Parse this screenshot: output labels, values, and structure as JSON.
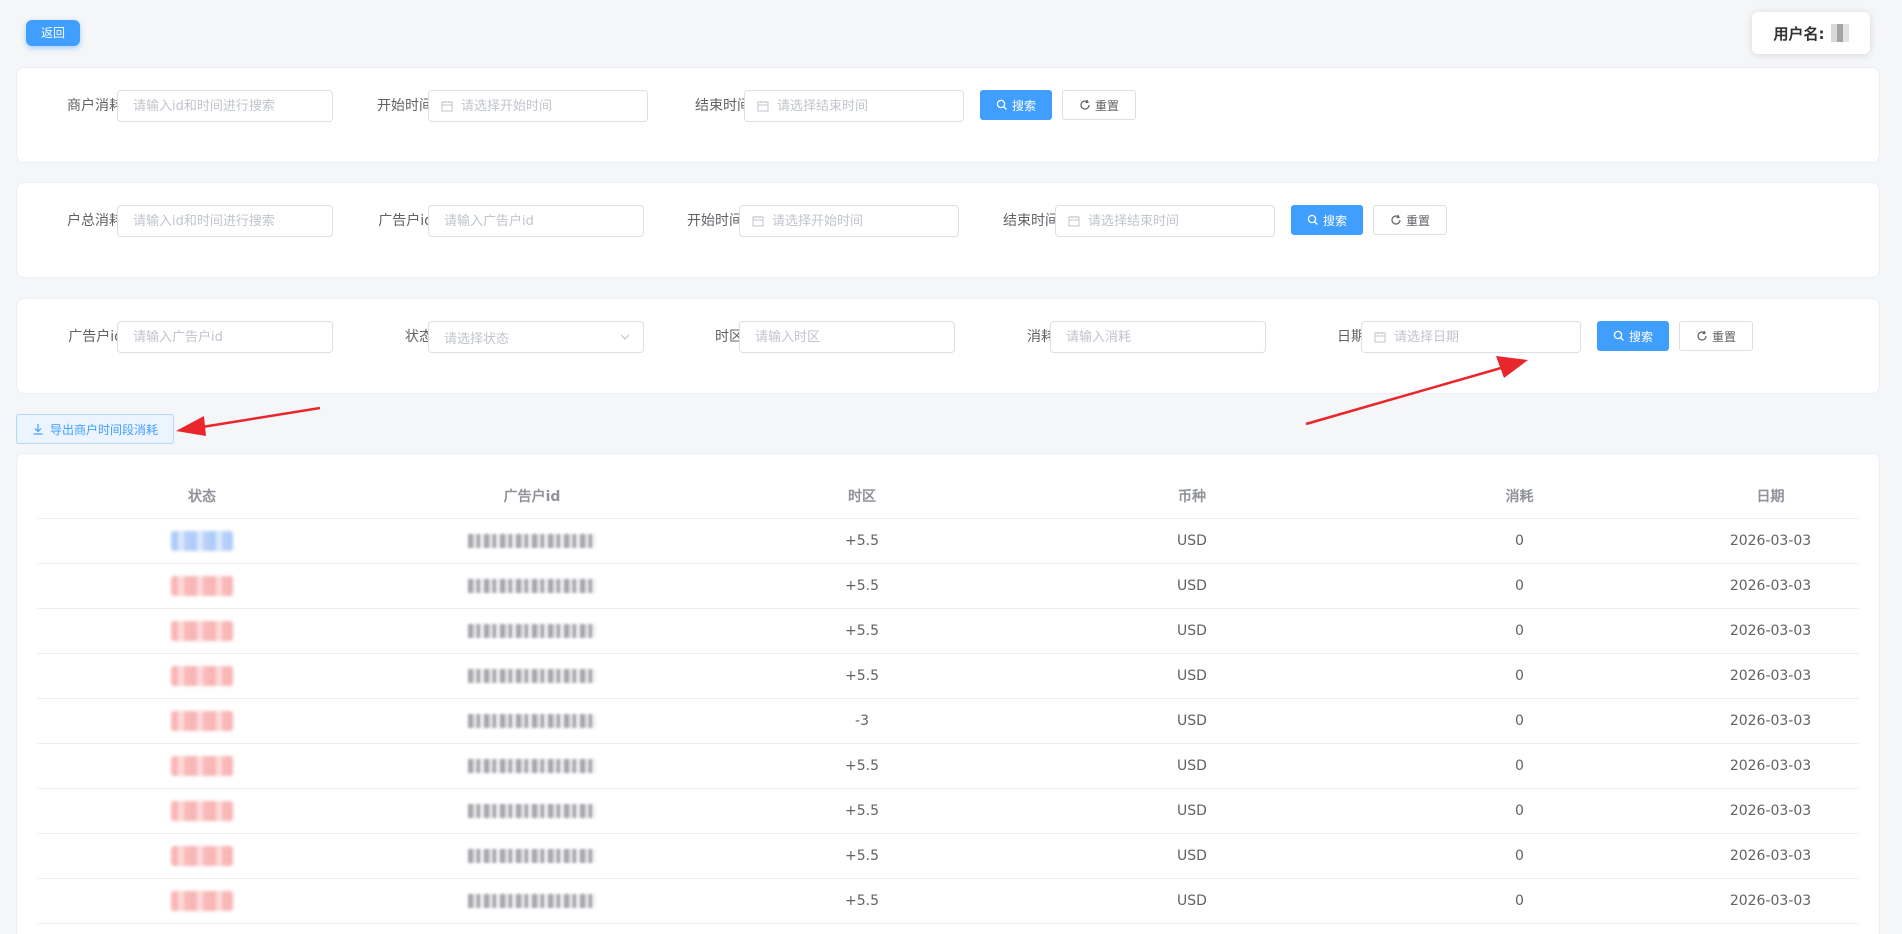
{
  "header": {
    "back_label": "返回",
    "user_label": "用户名:"
  },
  "merchant_form": {
    "label": "商户消耗",
    "placeholder": "请输入id和时间进行搜索",
    "start_label": "开始时间",
    "start_placeholder": "请选择开始时间",
    "end_label": "结束时间",
    "end_placeholder": "请选择结束时间",
    "search_label": "搜索",
    "reset_label": "重置"
  },
  "account_total_form": {
    "label": "户总消耗",
    "placeholder": "请输入id和时间进行搜索",
    "ad_id_label": "广告户id",
    "ad_id_placeholder": "请输入广告户id",
    "start_label": "开始时间",
    "start_placeholder": "请选择开始时间",
    "end_label": "结束时间",
    "end_placeholder": "请选择结束时间",
    "search_label": "搜索",
    "reset_label": "重置"
  },
  "detail_form": {
    "ad_id_label": "广告户id",
    "ad_id_placeholder": "请输入广告户id",
    "status_label": "状态",
    "status_placeholder": "请选择状态",
    "timezone_label": "时区",
    "timezone_placeholder": "请输入时区",
    "consume_label": "消耗",
    "consume_placeholder": "请输入消耗",
    "date_label": "日期",
    "date_placeholder": "请选择日期",
    "search_label": "搜索",
    "reset_label": "重置"
  },
  "export_label": "导出商户时间段消耗",
  "table": {
    "columns": [
      "状态",
      "广告户id",
      "时区",
      "币种",
      "消耗",
      "日期"
    ],
    "rows": [
      {
        "timezone": "+5.5",
        "currency": "USD",
        "consume": "0",
        "date": "2026-03-03"
      },
      {
        "timezone": "+5.5",
        "currency": "USD",
        "consume": "0",
        "date": "2026-03-03"
      },
      {
        "timezone": "+5.5",
        "currency": "USD",
        "consume": "0",
        "date": "2026-03-03"
      },
      {
        "timezone": "+5.5",
        "currency": "USD",
        "consume": "0",
        "date": "2026-03-03"
      },
      {
        "timezone": "-3",
        "currency": "USD",
        "consume": "0",
        "date": "2026-03-03"
      },
      {
        "timezone": "+5.5",
        "currency": "USD",
        "consume": "0",
        "date": "2026-03-03"
      },
      {
        "timezone": "+5.5",
        "currency": "USD",
        "consume": "0",
        "date": "2026-03-03"
      },
      {
        "timezone": "+5.5",
        "currency": "USD",
        "consume": "0",
        "date": "2026-03-03"
      },
      {
        "timezone": "+5.5",
        "currency": "USD",
        "consume": "0",
        "date": "2026-03-03"
      }
    ]
  },
  "colors": {
    "primary": "#409eff",
    "annotation_arrow": "#e8262b",
    "page_background": "#f5f6f8"
  }
}
